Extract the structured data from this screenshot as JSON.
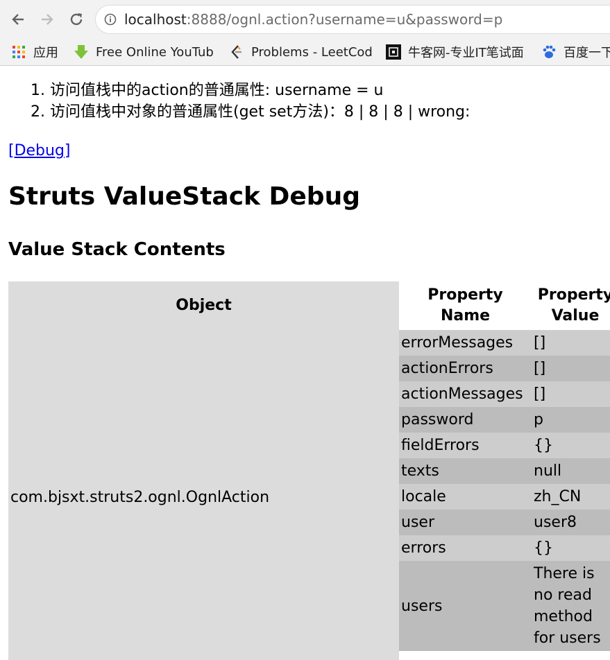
{
  "browser": {
    "url_host": "localhost",
    "url_rest": ":8888/ognl.action?username=u&password=p",
    "bookmarks": [
      {
        "label": "应用",
        "icon": "apps-grid-icon"
      },
      {
        "label": "Free Online YouTub",
        "icon": "download-arrow-icon"
      },
      {
        "label": "Problems - LeetCod",
        "icon": "leetcode-icon"
      },
      {
        "label": "牛客网-专业IT笔试面",
        "icon": "nowcoder-icon"
      },
      {
        "label": "百度一下",
        "icon": "baidu-paw-icon"
      }
    ]
  },
  "page": {
    "list": [
      "访问值栈中的action的普通属性: username = u",
      "访问值栈中对象的普通属性(get set方法)：8 | 8 | 8 | wrong:"
    ],
    "debug_link": "[Debug]",
    "title": "Struts ValueStack Debug",
    "subtitle": "Value Stack Contents"
  },
  "table": {
    "headers": {
      "object": "Object",
      "prop_name": "Property Name",
      "prop_value": "Property Value"
    },
    "object_name": "com.bjsxt.struts2.ognl.OgnlAction",
    "rows": [
      {
        "name": "errorMessages",
        "value": "[]"
      },
      {
        "name": "actionErrors",
        "value": "[]"
      },
      {
        "name": "actionMessages",
        "value": "[]"
      },
      {
        "name": "password",
        "value": "p"
      },
      {
        "name": "fieldErrors",
        "value": "{}"
      },
      {
        "name": "texts",
        "value": "null"
      },
      {
        "name": "locale",
        "value": "zh_CN"
      },
      {
        "name": "user",
        "value": "user8"
      },
      {
        "name": "errors",
        "value": "{}"
      },
      {
        "name": "users",
        "value": "There is no read method for users"
      }
    ]
  }
}
